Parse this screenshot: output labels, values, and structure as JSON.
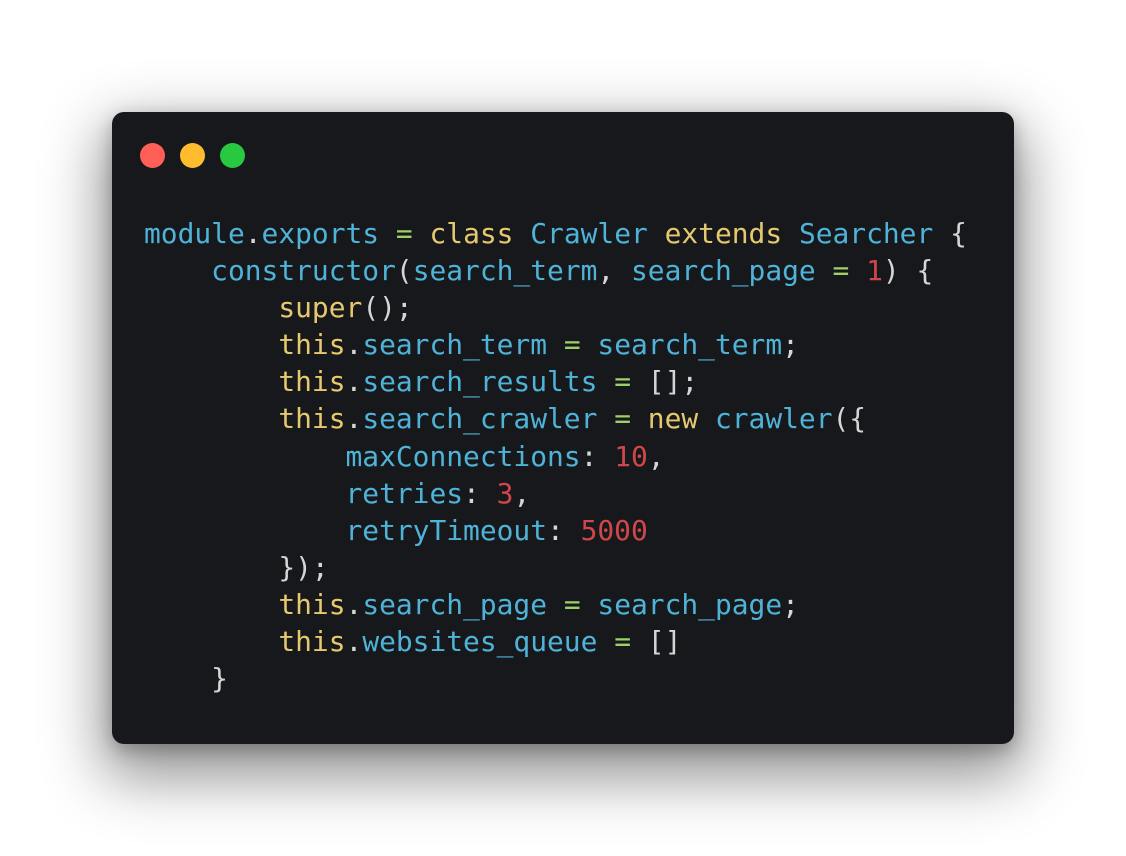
{
  "window": {
    "background": "#17181b",
    "controls": [
      {
        "name": "close",
        "color": "#ff5f57"
      },
      {
        "name": "minimize",
        "color": "#febc2e"
      },
      {
        "name": "zoom",
        "color": "#28c840"
      }
    ]
  },
  "colors": {
    "identifier": "#4fb3d8",
    "keyword": "#e6c86f",
    "operator": "#9ed06a",
    "number": "#d0474b",
    "punctuation": "#d6d6d6"
  },
  "code": {
    "language": "javascript",
    "lines": [
      [
        [
          "identifier",
          "module"
        ],
        [
          "punctuation",
          "."
        ],
        [
          "identifier",
          "exports"
        ],
        [
          "text",
          " "
        ],
        [
          "operator",
          "="
        ],
        [
          "text",
          " "
        ],
        [
          "keyword",
          "class"
        ],
        [
          "text",
          " "
        ],
        [
          "identifier",
          "Crawler"
        ],
        [
          "text",
          " "
        ],
        [
          "keyword",
          "extends"
        ],
        [
          "text",
          " "
        ],
        [
          "identifier",
          "Searcher"
        ],
        [
          "text",
          " "
        ],
        [
          "punctuation",
          "{"
        ]
      ],
      [
        [
          "text",
          "    "
        ],
        [
          "identifier",
          "constructor"
        ],
        [
          "punctuation",
          "("
        ],
        [
          "identifier",
          "search_term"
        ],
        [
          "punctuation",
          ","
        ],
        [
          "text",
          " "
        ],
        [
          "identifier",
          "search_page"
        ],
        [
          "text",
          " "
        ],
        [
          "operator",
          "="
        ],
        [
          "text",
          " "
        ],
        [
          "number",
          "1"
        ],
        [
          "punctuation",
          ")"
        ],
        [
          "text",
          " "
        ],
        [
          "punctuation",
          "{"
        ]
      ],
      [
        [
          "text",
          "        "
        ],
        [
          "keyword",
          "super"
        ],
        [
          "punctuation",
          "();"
        ]
      ],
      [
        [
          "text",
          "        "
        ],
        [
          "keyword",
          "this"
        ],
        [
          "punctuation",
          "."
        ],
        [
          "identifier",
          "search_term"
        ],
        [
          "text",
          " "
        ],
        [
          "operator",
          "="
        ],
        [
          "text",
          " "
        ],
        [
          "identifier",
          "search_term"
        ],
        [
          "punctuation",
          ";"
        ]
      ],
      [
        [
          "text",
          "        "
        ],
        [
          "keyword",
          "this"
        ],
        [
          "punctuation",
          "."
        ],
        [
          "identifier",
          "search_results"
        ],
        [
          "text",
          " "
        ],
        [
          "operator",
          "="
        ],
        [
          "text",
          " "
        ],
        [
          "punctuation",
          "[];"
        ]
      ],
      [
        [
          "text",
          "        "
        ],
        [
          "keyword",
          "this"
        ],
        [
          "punctuation",
          "."
        ],
        [
          "identifier",
          "search_crawler"
        ],
        [
          "text",
          " "
        ],
        [
          "operator",
          "="
        ],
        [
          "text",
          " "
        ],
        [
          "keyword",
          "new"
        ],
        [
          "text",
          " "
        ],
        [
          "identifier",
          "crawler"
        ],
        [
          "punctuation",
          "({"
        ]
      ],
      [
        [
          "text",
          "            "
        ],
        [
          "identifier",
          "maxConnections"
        ],
        [
          "punctuation",
          ":"
        ],
        [
          "text",
          " "
        ],
        [
          "number",
          "10"
        ],
        [
          "punctuation",
          ","
        ]
      ],
      [
        [
          "text",
          "            "
        ],
        [
          "identifier",
          "retries"
        ],
        [
          "punctuation",
          ":"
        ],
        [
          "text",
          " "
        ],
        [
          "number",
          "3"
        ],
        [
          "punctuation",
          ","
        ]
      ],
      [
        [
          "text",
          "            "
        ],
        [
          "identifier",
          "retryTimeout"
        ],
        [
          "punctuation",
          ":"
        ],
        [
          "text",
          " "
        ],
        [
          "number",
          "5000"
        ]
      ],
      [
        [
          "text",
          "        "
        ],
        [
          "punctuation",
          "});"
        ]
      ],
      [
        [
          "text",
          "        "
        ],
        [
          "keyword",
          "this"
        ],
        [
          "punctuation",
          "."
        ],
        [
          "identifier",
          "search_page"
        ],
        [
          "text",
          " "
        ],
        [
          "operator",
          "="
        ],
        [
          "text",
          " "
        ],
        [
          "identifier",
          "search_page"
        ],
        [
          "punctuation",
          ";"
        ]
      ],
      [
        [
          "text",
          "        "
        ],
        [
          "keyword",
          "this"
        ],
        [
          "punctuation",
          "."
        ],
        [
          "identifier",
          "websites_queue"
        ],
        [
          "text",
          " "
        ],
        [
          "operator",
          "="
        ],
        [
          "text",
          " "
        ],
        [
          "punctuation",
          "[]"
        ]
      ],
      [
        [
          "text",
          "    "
        ],
        [
          "punctuation",
          "}"
        ]
      ]
    ]
  }
}
